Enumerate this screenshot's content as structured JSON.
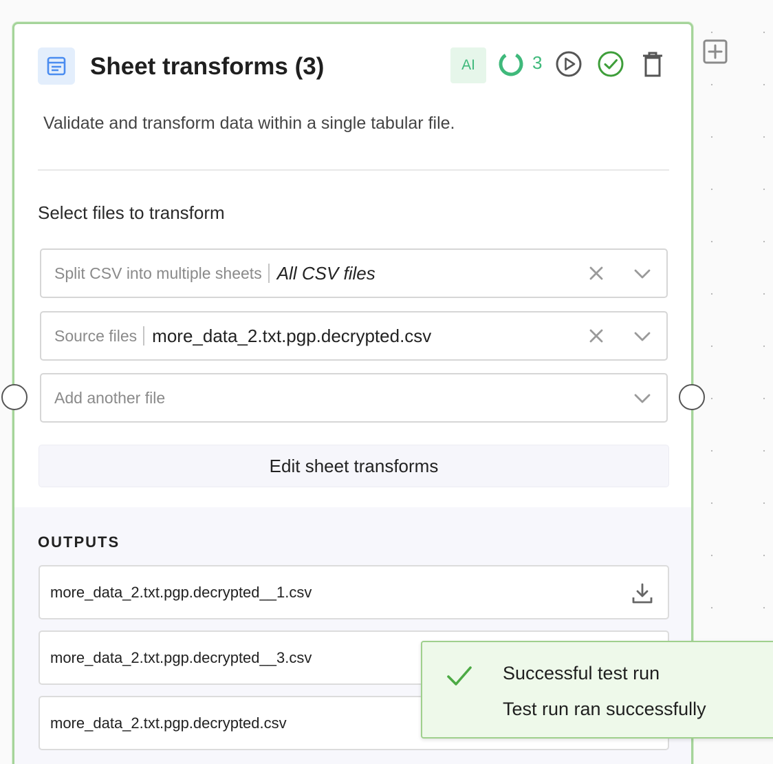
{
  "node": {
    "title": "Sheet transforms (3)",
    "ai_badge": "AI",
    "counter": "3",
    "description": "Validate and transform data within a single tabular file.",
    "section_label": "Select files to transform",
    "selects": [
      {
        "prefix": "Split CSV into multiple sheets",
        "value": "All CSV files"
      },
      {
        "prefix": "Source files",
        "value": "more_data_2.txt.pgp.decrypted.csv"
      }
    ],
    "add_placeholder": "Add another file",
    "edit_button": "Edit sheet transforms",
    "outputs_label": "OUTPUTS",
    "outputs": [
      "more_data_2.txt.pgp.decrypted__1.csv",
      "more_data_2.txt.pgp.decrypted__3.csv",
      "more_data_2.txt.pgp.decrypted.csv"
    ]
  },
  "toast": {
    "title": "Successful test run",
    "message": "Test run ran successfully"
  },
  "colors": {
    "accent_green": "#3fb97b",
    "card_border": "#a5d49a",
    "toast_bg": "#eef9ea"
  }
}
